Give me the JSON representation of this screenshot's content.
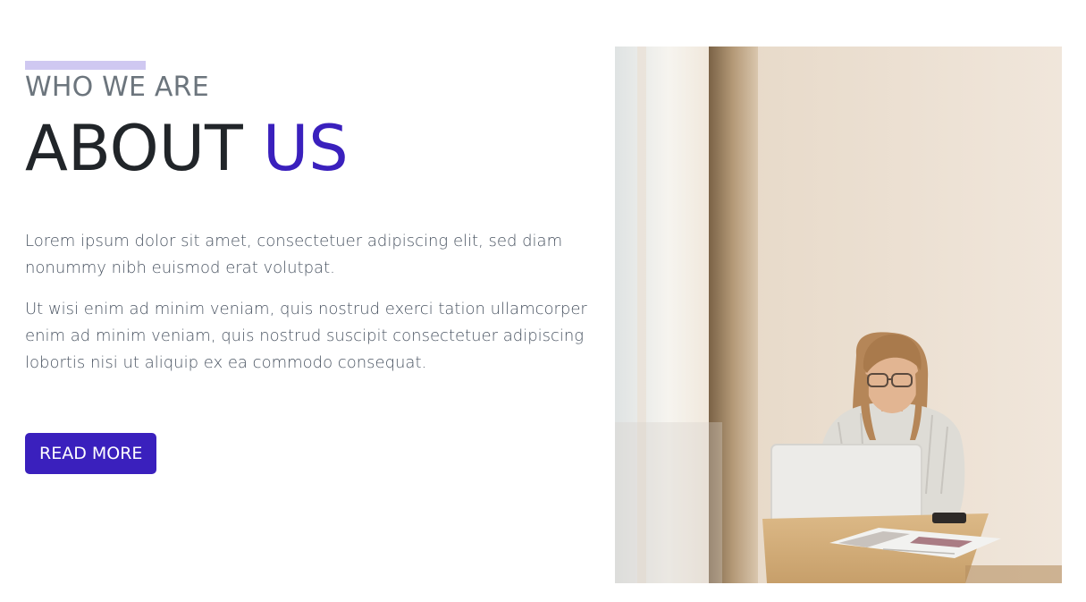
{
  "section": {
    "eyebrow": "WHO WE ARE",
    "title_main": "ABOUT",
    "title_highlight": "US",
    "paragraphs": [
      "Lorem ipsum dolor sit amet, consectetuer adipiscing elit, sed diam nonummy nibh euismod erat volutpat.",
      "Ut wisi enim ad minim veniam, quis nostrud exerci tation ullamcorper enim ad minim veniam, quis nostrud suscipit consectetuer adipiscing lobortis nisi ut aliquip ex ea commodo consequat."
    ],
    "button_label": "READ MORE"
  },
  "colors": {
    "accent": "#3a20bd",
    "accent_light": "#cfc8f1",
    "heading": "#212529",
    "muted": "#6c757d"
  }
}
